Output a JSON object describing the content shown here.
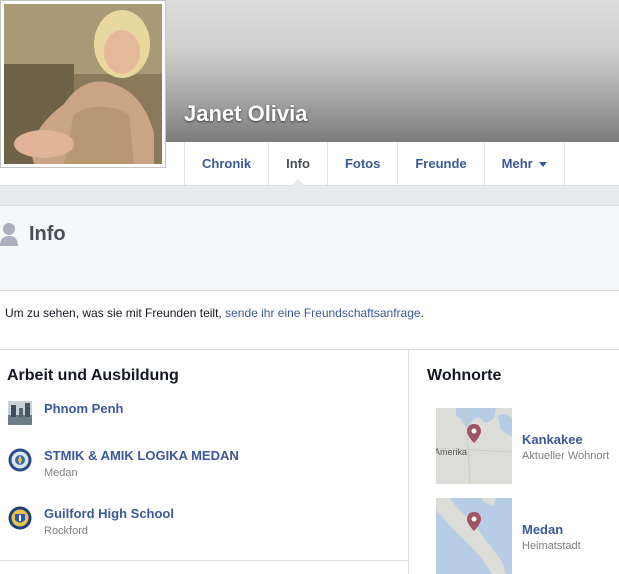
{
  "profile": {
    "name": "Janet Olivia"
  },
  "tabs": [
    {
      "label": "Chronik",
      "active": false
    },
    {
      "label": "Info",
      "active": true
    },
    {
      "label": "Fotos",
      "active": false
    },
    {
      "label": "Freunde",
      "active": false
    },
    {
      "label": "Mehr",
      "active": false
    }
  ],
  "info": {
    "title": "Info",
    "notice_text": "Um zu sehen, was sie mit Freunden teilt, ",
    "notice_link": "sende ihr eine Freundschaftsanfrage",
    "notice_end": "."
  },
  "work": {
    "title": "Arbeit und Ausbildung",
    "items": [
      {
        "name": "Phnom Penh",
        "sub": ""
      },
      {
        "name": "STMIK & AMIK LOGIKA MEDAN",
        "sub": "Medan"
      },
      {
        "name": "Guilford High School",
        "sub": "Rockford"
      }
    ]
  },
  "places": {
    "title": "Wohnorte",
    "items": [
      {
        "name": "Kankakee",
        "sub": "Aktueller Wohnort",
        "map_label": "Amerika"
      },
      {
        "name": "Medan",
        "sub": "Heimatstadt"
      }
    ]
  },
  "colors": {
    "link": "#3b5998",
    "pin": "#a05565"
  }
}
